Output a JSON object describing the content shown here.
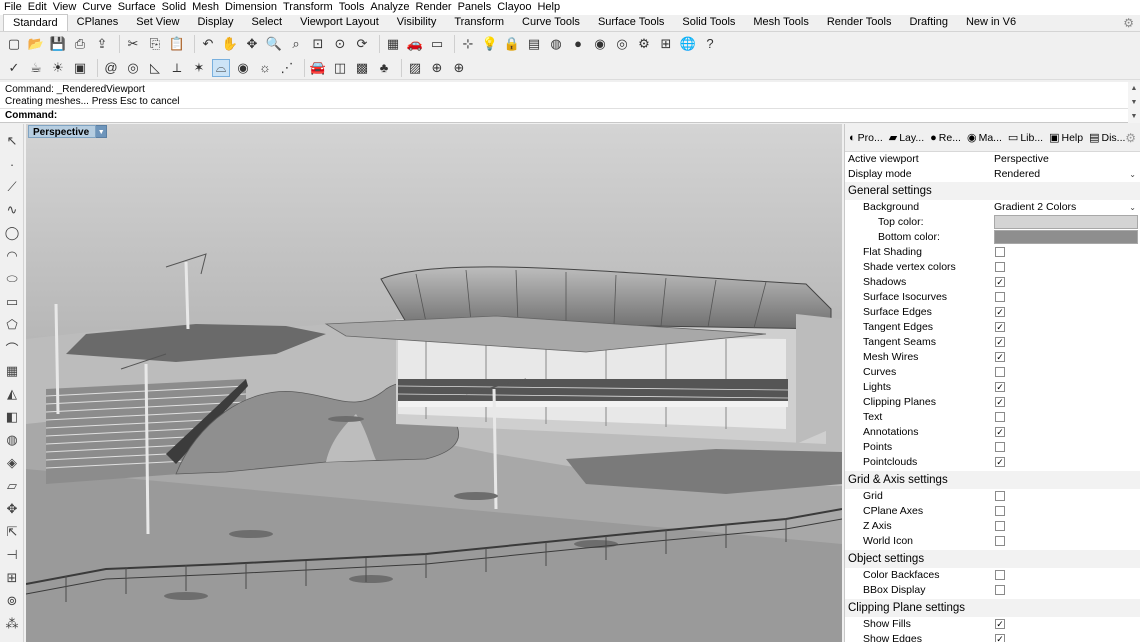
{
  "menu": [
    "File",
    "Edit",
    "View",
    "Curve",
    "Surface",
    "Solid",
    "Mesh",
    "Dimension",
    "Transform",
    "Tools",
    "Analyze",
    "Render",
    "Panels",
    "Clayoo",
    "Help"
  ],
  "tabs": [
    "Standard",
    "CPlanes",
    "Set View",
    "Display",
    "Select",
    "Viewport Layout",
    "Visibility",
    "Transform",
    "Curve Tools",
    "Surface Tools",
    "Solid Tools",
    "Mesh Tools",
    "Render Tools",
    "Drafting",
    "New in V6"
  ],
  "active_tab": "Standard",
  "toolbar1_icons": [
    "new-icon",
    "open-icon",
    "save-icon",
    "print-icon",
    "import-icon",
    "cut-icon",
    "copy-icon",
    "paste-icon",
    "undo-icon",
    "pan-icon",
    "move-view-icon",
    "zoom-icon",
    "zoom-window-icon",
    "zoom-extents-icon",
    "zoom-selected-icon",
    "rotate-view-icon",
    "four-viewports-icon",
    "car-icon",
    "wireframe-icon",
    "cplane-icon",
    "light-icon",
    "lock-icon",
    "layer-icon",
    "color-wheel-icon",
    "sphere-icon",
    "render-sphere-icon",
    "material-sphere-icon",
    "settings-icon",
    "grid-snap-icon",
    "globe-icon",
    "help-icon"
  ],
  "toolbar2_icons": [
    "check-icon",
    "teapot-icon",
    "sun-teapot-icon",
    "render-window-icon",
    "spiral-icon",
    "ring-icon",
    "protractor-icon",
    "spotlight-icon",
    "point-light-icon",
    "dome-icon",
    "target-icon",
    "sun-icon",
    "directional-light-icon",
    "car-render-icon",
    "box-icon",
    "box-render-icon",
    "plant-icon",
    "texture-icon",
    "globe-grid-icon",
    "crosshair-icon"
  ],
  "command": {
    "history": [
      "Command: _RenderedViewport",
      "Creating meshes... Press Esc to cancel"
    ],
    "prompt_label": "Command:",
    "prompt_value": ""
  },
  "viewport": {
    "title": "Perspective"
  },
  "panel": {
    "tabs": [
      {
        "label": "Pro...",
        "icon": "properties-icon",
        "glyph": "◐"
      },
      {
        "label": "Lay...",
        "icon": "layers-icon",
        "glyph": "▰"
      },
      {
        "label": "Re...",
        "icon": "render-icon",
        "glyph": "●"
      },
      {
        "label": "Ma...",
        "icon": "materials-icon",
        "glyph": "◉"
      },
      {
        "label": "Lib...",
        "icon": "libraries-icon",
        "glyph": "▭"
      },
      {
        "label": "Help",
        "icon": "help-icon",
        "glyph": "▣"
      },
      {
        "label": "Dis...",
        "icon": "display-icon",
        "glyph": "▤"
      }
    ],
    "active_viewport_label": "Active viewport",
    "active_viewport_value": "Perspective",
    "display_mode_label": "Display mode",
    "display_mode_value": "Rendered",
    "general_title": "General settings",
    "background_label": "Background",
    "background_value": "Gradient 2 Colors",
    "top_color_label": "Top color:",
    "top_color": "#d4d4d4",
    "bottom_color_label": "Bottom color:",
    "bottom_color": "#8e8e8e",
    "general": [
      {
        "label": "Flat Shading",
        "checked": false
      },
      {
        "label": "Shade vertex colors",
        "checked": false
      },
      {
        "label": "Shadows",
        "checked": true
      },
      {
        "label": "Surface Isocurves",
        "checked": false
      },
      {
        "label": "Surface Edges",
        "checked": true
      },
      {
        "label": "Tangent Edges",
        "checked": true
      },
      {
        "label": "Tangent Seams",
        "checked": true
      },
      {
        "label": "Mesh Wires",
        "checked": true
      },
      {
        "label": "Curves",
        "checked": false
      },
      {
        "label": "Lights",
        "checked": true
      },
      {
        "label": "Clipping Planes",
        "checked": true
      },
      {
        "label": "Text",
        "checked": false
      },
      {
        "label": "Annotations",
        "checked": true
      },
      {
        "label": "Points",
        "checked": false
      },
      {
        "label": "Pointclouds",
        "checked": true
      }
    ],
    "grid_title": "Grid & Axis settings",
    "grid": [
      {
        "label": "Grid",
        "checked": false
      },
      {
        "label": "CPlane Axes",
        "checked": false
      },
      {
        "label": "Z Axis",
        "checked": false
      },
      {
        "label": "World Icon",
        "checked": false
      }
    ],
    "object_title": "Object settings",
    "object": [
      {
        "label": "Color Backfaces",
        "checked": false
      },
      {
        "label": "BBox Display",
        "checked": false
      }
    ],
    "clipping_title": "Clipping Plane settings",
    "clipping": [
      {
        "label": "Show Fills",
        "checked": true
      },
      {
        "label": "Show Edges",
        "checked": true
      }
    ]
  }
}
